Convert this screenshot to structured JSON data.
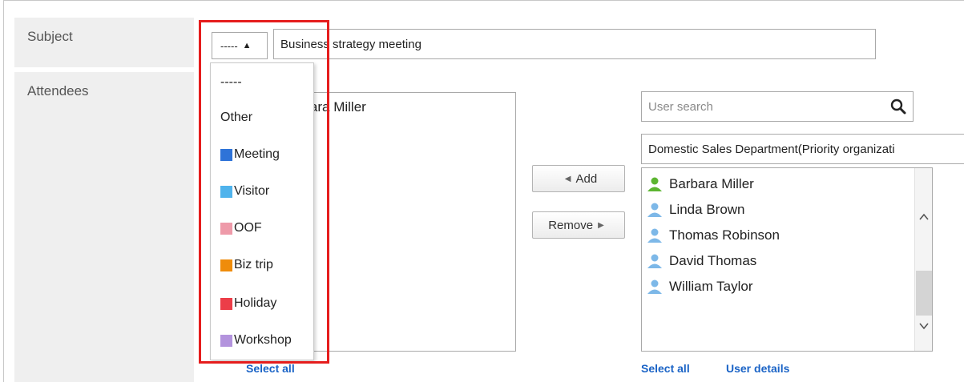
{
  "labels": {
    "subject": "Subject",
    "attendees": "Attendees"
  },
  "subject": {
    "type_value": "-----",
    "title_value": "Business strategy meeting"
  },
  "type_dropdown": {
    "options": [
      {
        "label": "-----",
        "color": null
      },
      {
        "label": "Other",
        "color": null
      },
      {
        "label": "Meeting",
        "color": "#2e73d8"
      },
      {
        "label": "Visitor",
        "color": "#4fb3ec"
      },
      {
        "label": "OOF",
        "color": "#ee9aa9"
      },
      {
        "label": "Biz trip",
        "color": "#ef8c0b"
      },
      {
        "label": "Holiday",
        "color": "#ec3d48"
      },
      {
        "label": "Workshop",
        "color": "#b393dd"
      }
    ]
  },
  "selected_attendees": {
    "items": [
      "Barbara Miller"
    ],
    "select_all": "Select all"
  },
  "buttons": {
    "add": "Add",
    "remove": "Remove"
  },
  "user_picker": {
    "search_placeholder": "User search",
    "group_value": "Domestic Sales Department(Priority organizati",
    "users": [
      {
        "name": "Barbara Miller",
        "icon_color": "#5cb531"
      },
      {
        "name": "Linda Brown",
        "icon_color": "#7db8e8"
      },
      {
        "name": "Thomas Robinson",
        "icon_color": "#7db8e8"
      },
      {
        "name": "David Thomas",
        "icon_color": "#7db8e8"
      },
      {
        "name": "William Taylor",
        "icon_color": "#7db8e8"
      }
    ],
    "select_all": "Select all",
    "user_details": "User details"
  },
  "colors": {
    "highlight": "#e51d1d",
    "link": "#1a63c6",
    "label_bg": "#efefef"
  }
}
